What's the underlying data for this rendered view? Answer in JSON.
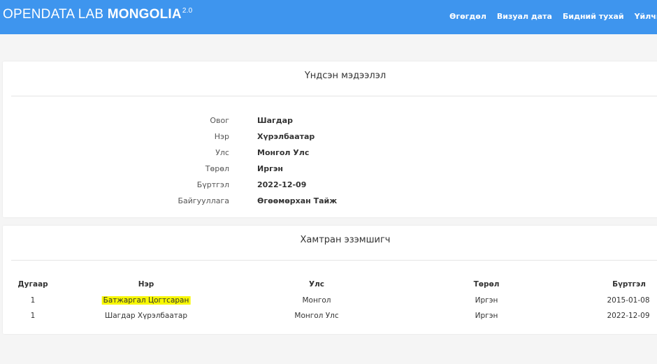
{
  "navbar": {
    "brand_light": "OPENDATA LAB ",
    "brand_bold": "MONGOLIA",
    "brand_sup": "2.0",
    "links": [
      "Өгөгдөл",
      "Визуал дата",
      "Бидний тухай",
      "Үйлчилгээний нө"
    ],
    "background": "#3e95ee"
  },
  "basic_info": {
    "title": "Үндсэн мэдээлэл",
    "rows": [
      {
        "label": "Овог",
        "value": "Шагдар"
      },
      {
        "label": "Нэр",
        "value": "Хүрэлбаатар"
      },
      {
        "label": "Улс",
        "value": "Монгол Улс"
      },
      {
        "label": "Төрөл",
        "value": "Иргэн"
      },
      {
        "label": "Бүртгэл",
        "value": "2022-12-09"
      },
      {
        "label": "Байгууллага",
        "value": "Өгөөмөрхан Тайж"
      }
    ]
  },
  "co_owners": {
    "title": "Хамтран эзэмшигч",
    "headers": [
      "Дугаар",
      "Нэр",
      "Улс",
      "Төрөл",
      "Бүртгэл"
    ],
    "rows": [
      [
        "1",
        "Батжаргал Цогтсаран",
        "Монгол",
        "Иргэн",
        "2015-01-08"
      ],
      [
        "1",
        "Шагдар Хүрэлбаатар",
        "Монгол Улс",
        "Иргэн",
        "2022-12-09"
      ]
    ],
    "highlight_color": "#f7f700"
  }
}
